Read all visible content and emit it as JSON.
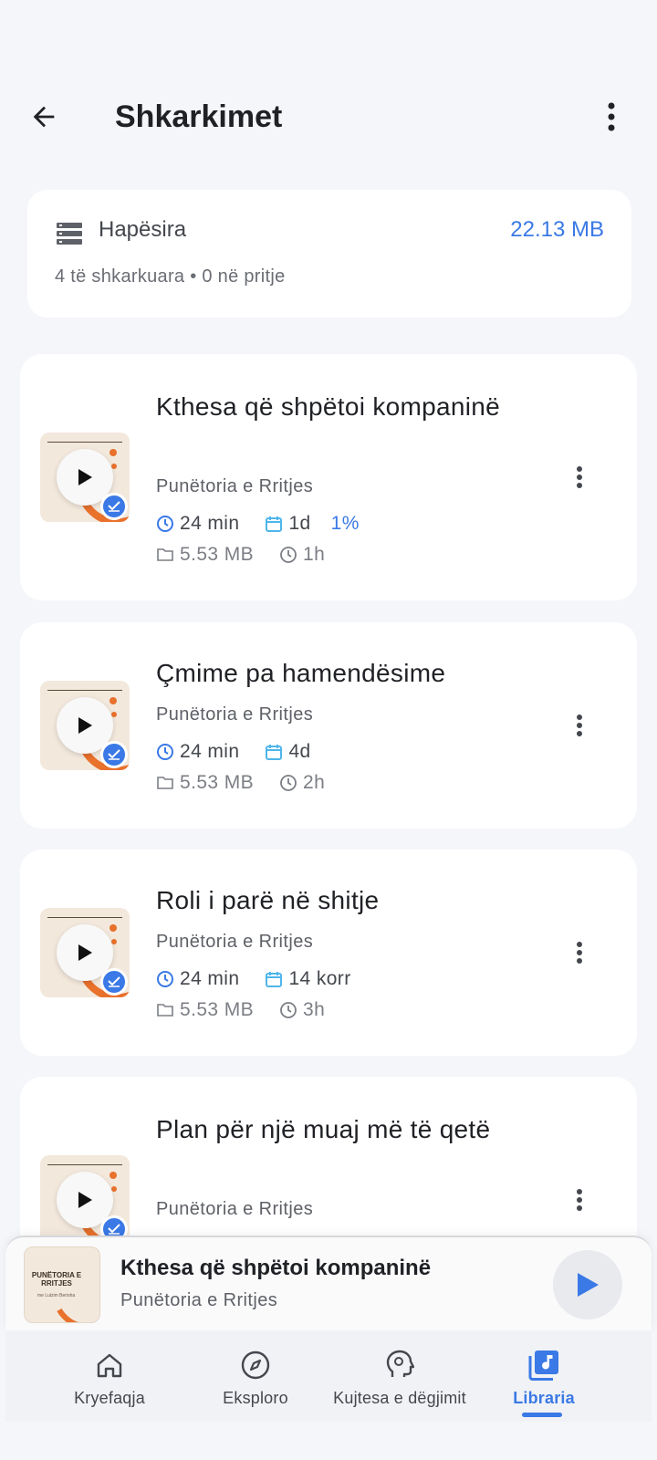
{
  "header": {
    "title": "Shkarkimet",
    "back_icon": "arrow-left-icon",
    "more_icon": "more-vertical-icon"
  },
  "storage": {
    "label": "Hapësira",
    "size": "22.13 MB",
    "summary": "4 të shkarkuara • 0 në pritje",
    "accent": "#3a79e6"
  },
  "episodes": [
    {
      "title": "Kthesa që shpëtoi kompaninë",
      "podcast": "Punëtoria e Rritjes",
      "duration": "24 min",
      "date": "1d",
      "progress": "1%",
      "file_size": "5.53 MB",
      "age": "1h"
    },
    {
      "title": "Çmime pa hamendësime",
      "podcast": "Punëtoria e Rritjes",
      "duration": "24 min",
      "date": "4d",
      "progress": "",
      "file_size": "5.53 MB",
      "age": "2h"
    },
    {
      "title": "Roli i parë në shitje",
      "podcast": "Punëtoria e Rritjes",
      "duration": "24 min",
      "date": "14 korr",
      "progress": "",
      "file_size": "5.53 MB",
      "age": "3h"
    },
    {
      "title": "Plan për një muaj më të qetë",
      "podcast": "Punëtoria e Rritjes",
      "duration": "",
      "date": "",
      "progress": "",
      "file_size": "",
      "age": ""
    }
  ],
  "mini_player": {
    "title": "Kthesa që shpëtoi kompaninë",
    "podcast": "Punëtoria e Rritjes",
    "art_brand": "PUNËTORIA E RRITJES",
    "art_sub": "me Lulzim Berisha"
  },
  "nav": {
    "items": [
      {
        "label": "Kryefaqja",
        "icon": "home-icon"
      },
      {
        "label": "Eksploro",
        "icon": "compass-icon"
      },
      {
        "label": "Kujtesa e dëgjimit",
        "icon": "head-gear-icon"
      },
      {
        "label": "Libraria",
        "icon": "library-music-icon"
      }
    ],
    "active": "Libraria"
  }
}
